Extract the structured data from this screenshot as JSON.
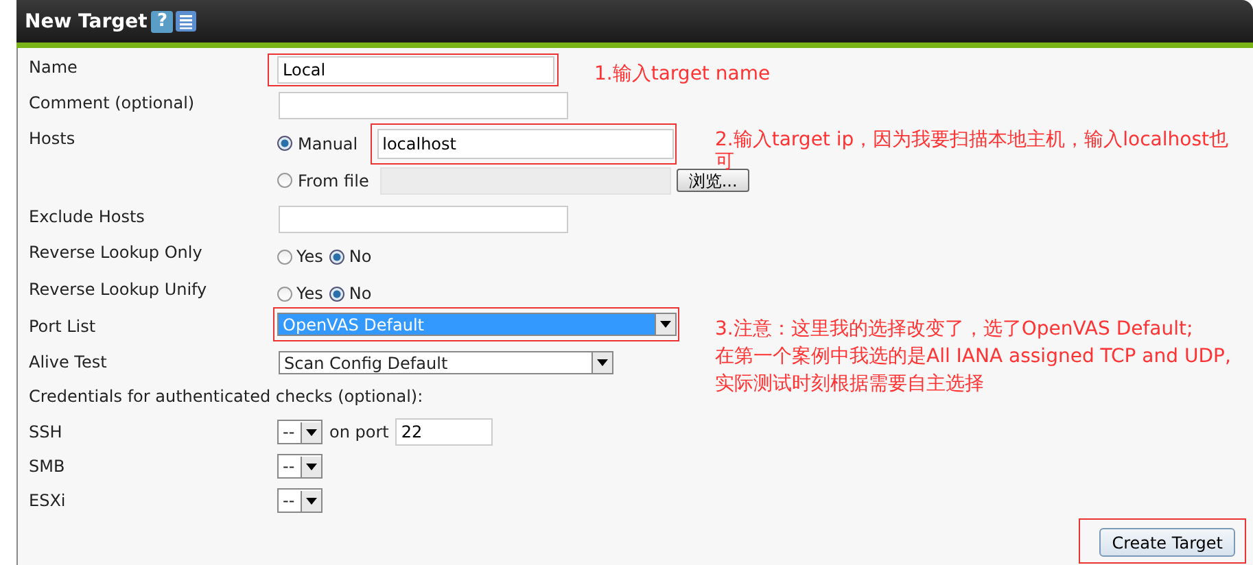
{
  "window": {
    "title": "New Target",
    "help_button": "?"
  },
  "fields": [
    {
      "kind": "text",
      "label": "Name",
      "value": "Local",
      "highlighted": true
    },
    {
      "kind": "text",
      "label": "Comment (optional)",
      "highlighted": false
    },
    {
      "kind": "hosts",
      "label": "Hosts",
      "highlighted": true,
      "options": [
        {
          "label": "Manual",
          "selected": true,
          "value": "localhost"
        },
        {
          "label": "From file",
          "selected": false,
          "button": "浏览..."
        }
      ]
    },
    {
      "kind": "text",
      "label": "Exclude Hosts",
      "highlighted": false
    },
    {
      "kind": "yesno",
      "label": "Reverse Lookup Only",
      "options": [
        {
          "label": "Yes",
          "selected": false
        },
        {
          "label": "No",
          "selected": true
        }
      ]
    },
    {
      "kind": "yesno",
      "label": "Reverse Lookup Unify",
      "options": [
        {
          "label": "Yes",
          "selected": false
        },
        {
          "label": "No",
          "selected": true
        }
      ]
    },
    {
      "kind": "select",
      "label": "Port List",
      "value": "OpenVAS Default",
      "focused": true,
      "highlighted": true
    },
    {
      "kind": "select",
      "label": "Alive Test",
      "value": "Scan Config Default",
      "focused": false,
      "highlighted": false
    },
    {
      "kind": "heading",
      "label": "Credentials for authenticated checks (optional):",
      "children": [
        {
          "kind": "credential",
          "label": "SSH",
          "value": "--",
          "port_label": "on port",
          "port": "22"
        },
        {
          "kind": "credential",
          "label": "SMB",
          "value": "--"
        },
        {
          "kind": "credential",
          "label": "ESXi",
          "value": "--"
        }
      ]
    }
  ],
  "submit": {
    "label": "Create Target",
    "highlighted": true
  },
  "annotations": [
    {
      "lines": [
        "1.输入target name"
      ]
    },
    {
      "lines": [
        "2.输入target ip，因为我要扫描本地主机，输入localhost也",
        "可"
      ]
    },
    {
      "lines": [
        "3.注意：这里我的选择改变了，选了OpenVAS Default;",
        "在第一个案例中我选的是All IANA assigned TCP and UDP,",
        "实际测试时刻根据需要自主选择"
      ]
    }
  ]
}
